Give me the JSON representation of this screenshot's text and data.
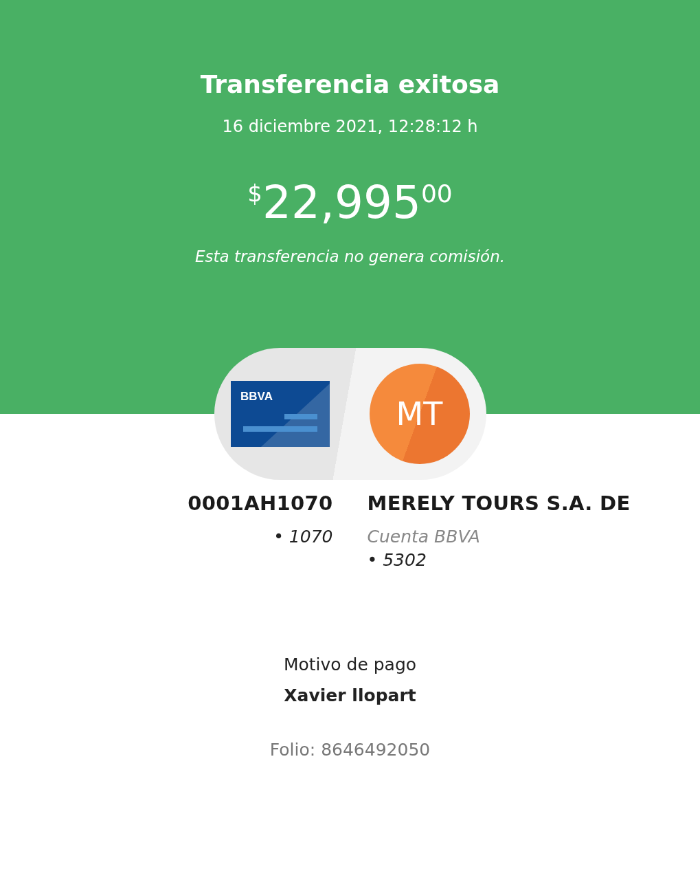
{
  "header": {
    "title": "Transferencia exitosa",
    "datetime": "16 diciembre 2021, 12:28:12 h",
    "amount": {
      "currency": "$",
      "integer": "22,995",
      "cents": "00"
    },
    "note": "Esta transferencia no genera comisión."
  },
  "source": {
    "card_logo": "BBVA",
    "name": "0001AH1070",
    "details": [
      "• 1070"
    ]
  },
  "destination": {
    "initials": "MT",
    "name": "MERELY TOURS S.A. DE",
    "bank": "Cuenta BBVA",
    "details": [
      "• 5302"
    ]
  },
  "payment_reason": {
    "label": "Motivo de pago",
    "value": "Xavier llopart"
  },
  "folio": "Folio: 8646492050"
}
